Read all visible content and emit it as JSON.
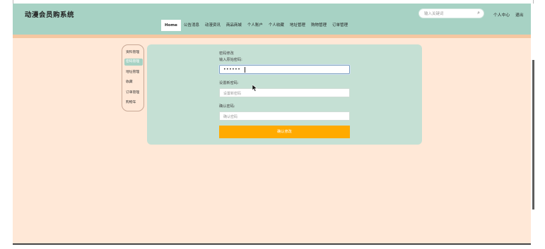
{
  "app": {
    "title": "动漫会员购系统"
  },
  "search": {
    "placeholder": "输入关键词",
    "icon": "search-icon"
  },
  "header_links": {
    "user_center": "个人中心",
    "logout": "退出"
  },
  "nav": {
    "items": [
      "Home",
      "公告消息",
      "动漫资讯",
      "商品商城",
      "个人账户",
      "个人收藏",
      "地址管理",
      "购物管理",
      "订单管理"
    ],
    "active_index": 0
  },
  "sidebar": {
    "items": [
      "资料管理",
      "密码管理",
      "地址管理",
      "收藏",
      "订单管理",
      "购物车"
    ],
    "active_index": 1
  },
  "form": {
    "title": "密码修改",
    "old_label": "输入原始密码:",
    "old_value": "••••••",
    "new_label": "设置新密码:",
    "new_placeholder": "设置新密码",
    "confirm_label": "确认密码:",
    "confirm_placeholder": "确认密码",
    "submit_label": "确认修改"
  },
  "colors": {
    "header_bg": "#a7d2c4",
    "accent_band": "#f5c7a1",
    "content_bg": "#ffe8d7",
    "panel_bg": "#c5e0d4",
    "button_bg": "#ffaa00"
  }
}
